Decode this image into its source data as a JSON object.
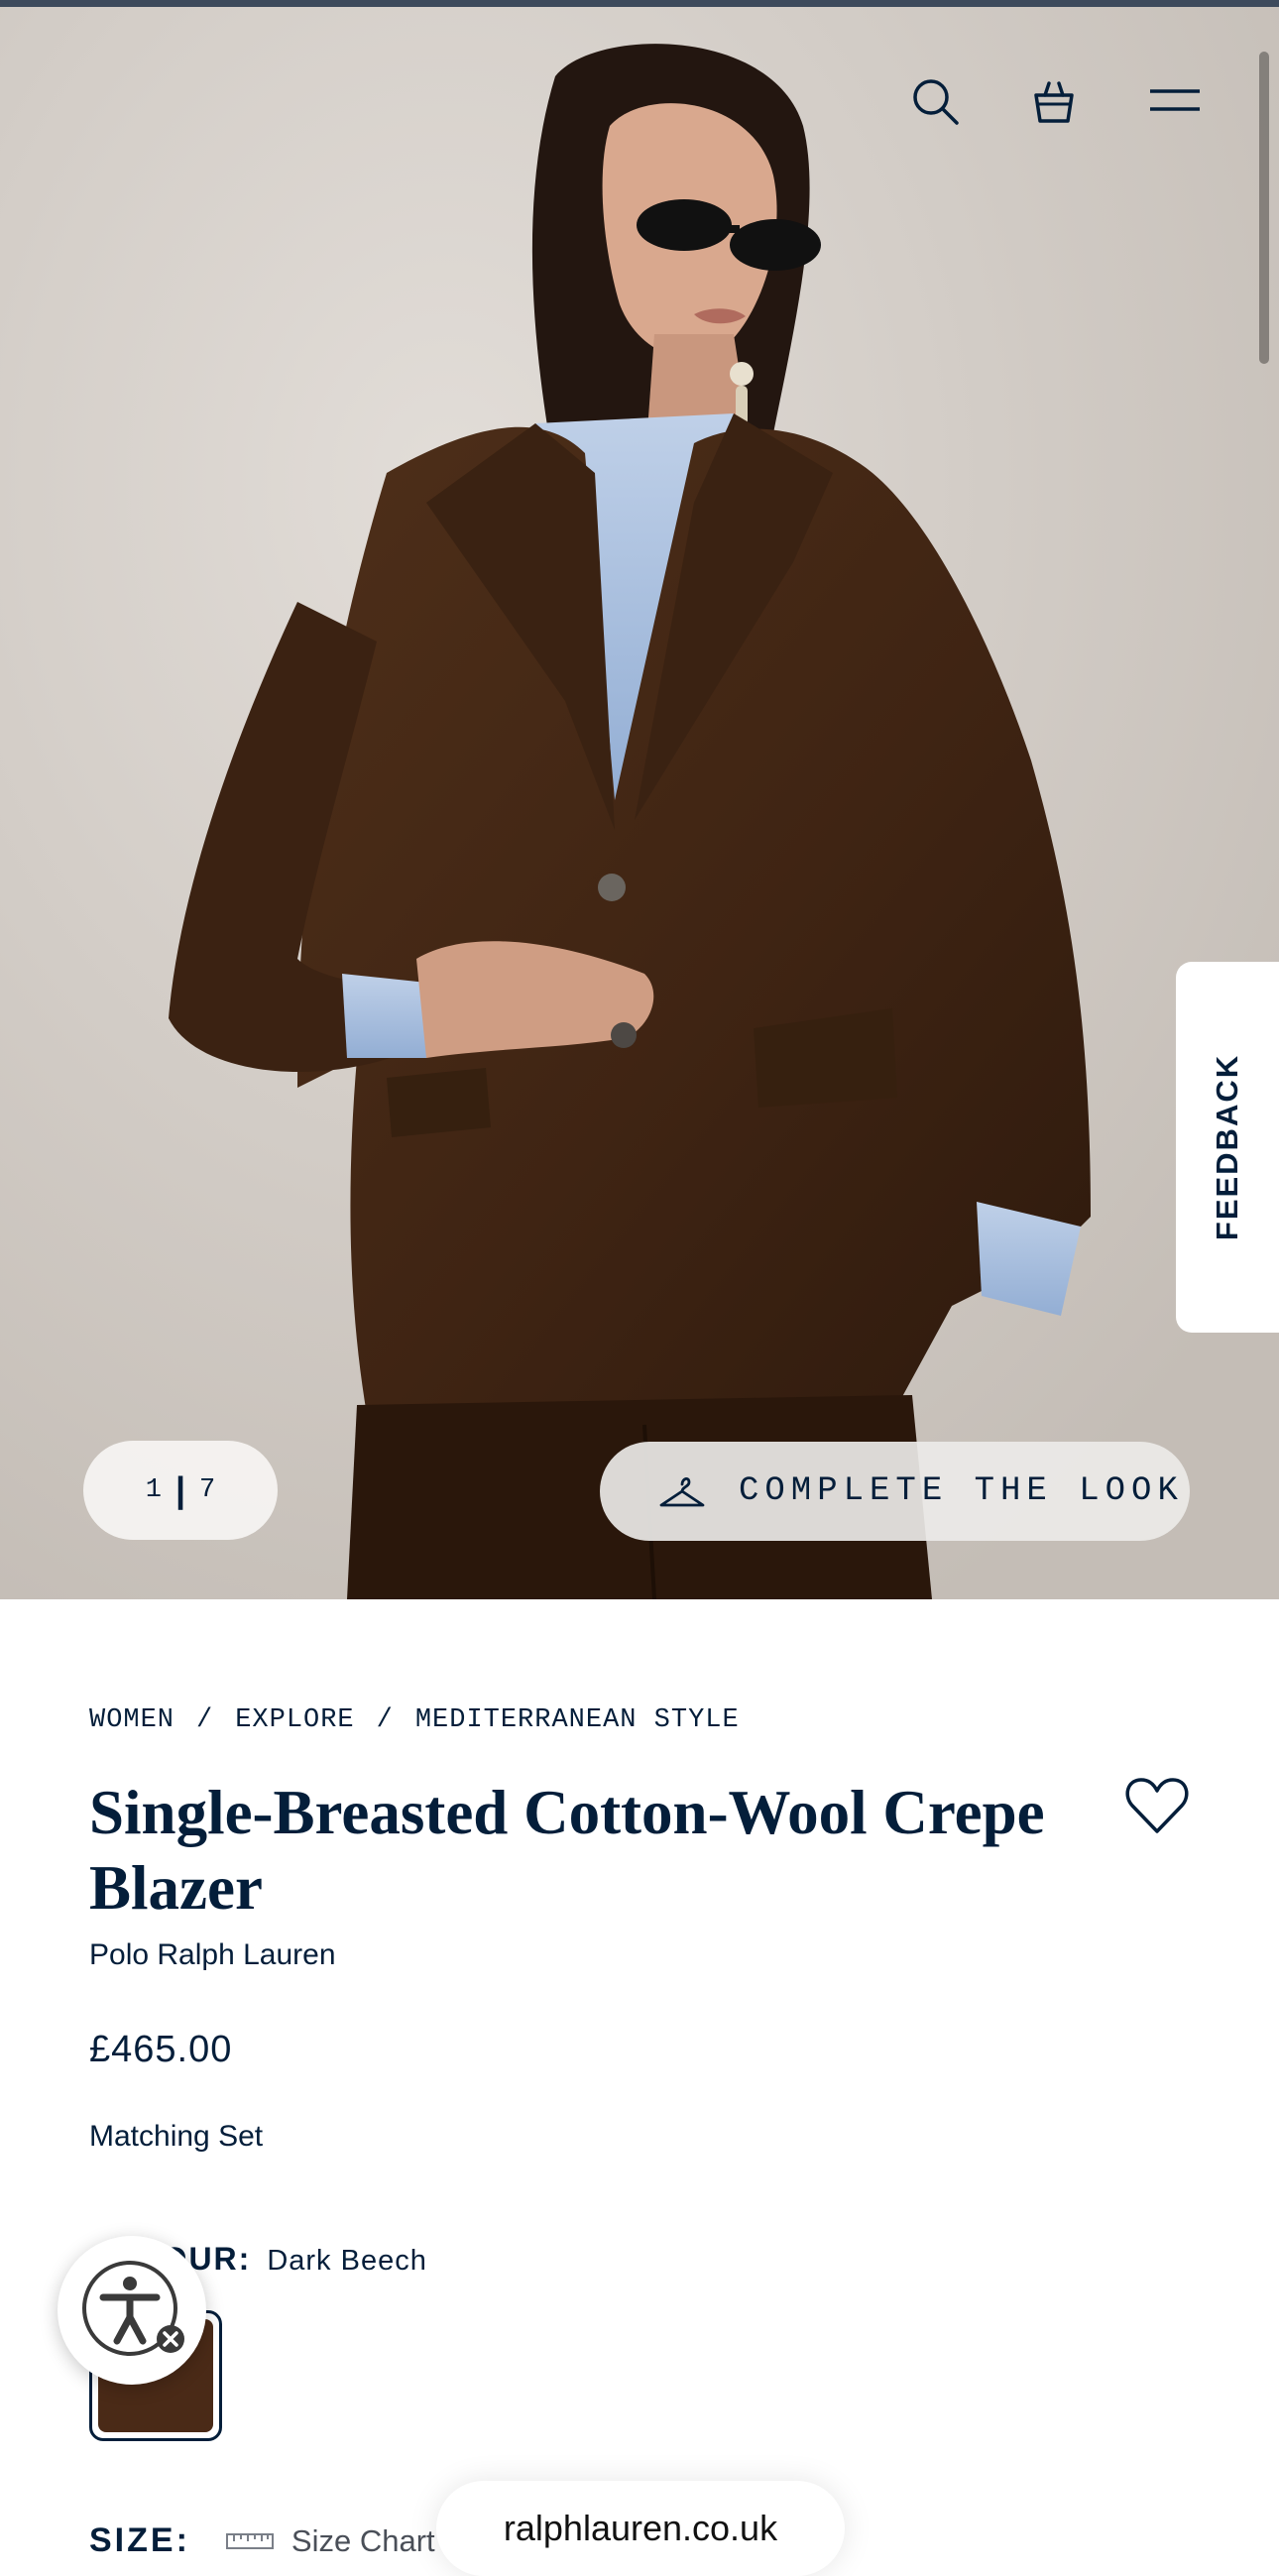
{
  "header": {
    "search_icon": "search-icon",
    "bag_icon": "shopping-bag-icon",
    "menu_icon": "hamburger-menu-icon"
  },
  "gallery": {
    "current": "1",
    "separator": "|",
    "total": "7",
    "complete_look_label": "COMPLETE THE LOOK",
    "complete_look_icon": "hanger-icon"
  },
  "feedback": {
    "label": "FEEDBACK"
  },
  "breadcrumb": {
    "items": [
      "WOMEN",
      "EXPLORE",
      "MEDITERRANEAN STYLE"
    ],
    "separator": "/"
  },
  "product": {
    "title": "Single-Breasted Cotton-Wool Crepe Blazer",
    "brand": "Polo Ralph Lauren",
    "price": "£465.00",
    "matching_set": "Matching Set",
    "colour_label": "COLOUR:",
    "colour_value": "Dark Beech",
    "swatch_color": "#4a2a17"
  },
  "size": {
    "label": "SIZE:",
    "chart_label": "Size Chart"
  },
  "browser": {
    "domain": "ralphlauren.co.uk"
  },
  "colors": {
    "navy": "#041e3a",
    "blazer_brown": "#4a2a17",
    "shirt_blue": "#a9c0de"
  }
}
